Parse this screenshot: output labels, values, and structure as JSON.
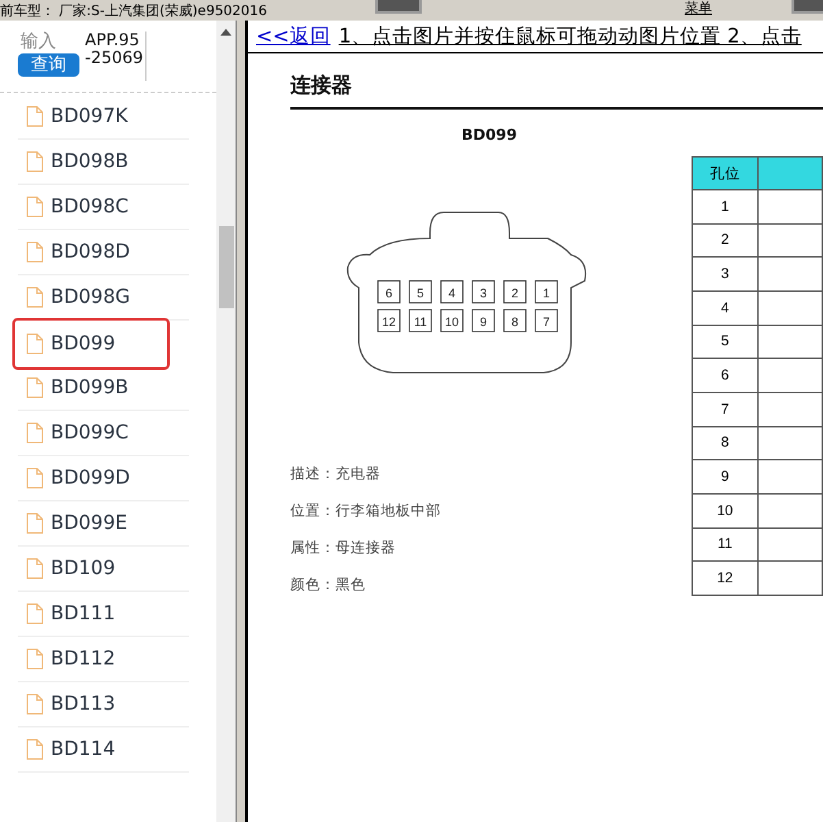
{
  "top_bar": {
    "vehicle": "前车型： 厂家:S-上汽集团(荣威)e9502016",
    "menu_label": "菜单"
  },
  "sidebar": {
    "search": {
      "placeholder": "输入"
    },
    "search_button": "查询",
    "app_code": "APP.95-25069",
    "items": [
      {
        "label": "BD097K",
        "selected": false
      },
      {
        "label": "BD098B",
        "selected": false
      },
      {
        "label": "BD098C",
        "selected": false
      },
      {
        "label": "BD098D",
        "selected": false
      },
      {
        "label": "BD098G",
        "selected": false
      },
      {
        "label": "BD099",
        "selected": true
      },
      {
        "label": "BD099B",
        "selected": false
      },
      {
        "label": "BD099C",
        "selected": false
      },
      {
        "label": "BD099D",
        "selected": false
      },
      {
        "label": "BD099E",
        "selected": false
      },
      {
        "label": "BD109",
        "selected": false
      },
      {
        "label": "BD111",
        "selected": false
      },
      {
        "label": "BD112",
        "selected": false
      },
      {
        "label": "BD113",
        "selected": false
      },
      {
        "label": "BD114",
        "selected": false
      }
    ]
  },
  "document": {
    "back_link": "<<返回",
    "instruction": "1、点击图片并按住鼠标可拖动动图片位置 2、点击",
    "title": "连接器",
    "connector_label": "BD099",
    "pins": [
      [
        "6",
        "5",
        "4",
        "3",
        "2",
        "1"
      ],
      [
        "12",
        "11",
        "10",
        "9",
        "8",
        "7"
      ]
    ],
    "table": {
      "columns": [
        "孔位"
      ],
      "rows": [
        "1",
        "2",
        "3",
        "4",
        "5",
        "6",
        "7",
        "8",
        "9",
        "10",
        "11",
        "12"
      ]
    },
    "properties": [
      "描述：充电器",
      "位置：行李箱地板中部",
      "属性：母连接器",
      "颜色：黑色"
    ]
  }
}
